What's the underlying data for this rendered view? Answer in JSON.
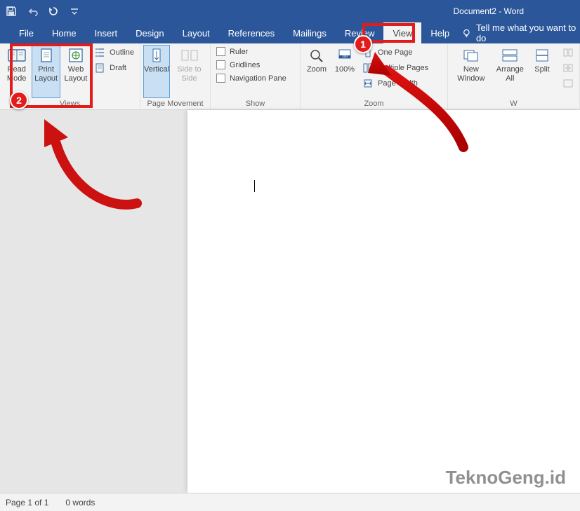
{
  "titlebar": {
    "title": "Document2  -  Word"
  },
  "tabs": {
    "file": "File",
    "home": "Home",
    "insert": "Insert",
    "design": "Design",
    "layout": "Layout",
    "references": "References",
    "mailings": "Mailings",
    "review": "Review",
    "view": "View",
    "help": "Help",
    "tellme": "Tell me what you want to do"
  },
  "ribbon": {
    "views": {
      "readmode": "Read Mode",
      "printlayout": "Print Layout",
      "weblayout": "Web Layout",
      "outline": "Outline",
      "draft": "Draft",
      "label": "Views"
    },
    "pagemovement": {
      "vertical": "Vertical",
      "side": "Side to Side",
      "label": "Page Movement"
    },
    "show": {
      "ruler": "Ruler",
      "gridlines": "Gridlines",
      "nav": "Navigation Pane",
      "label": "Show"
    },
    "zoom": {
      "zoom": "Zoom",
      "p100": "100%",
      "onepage": "One Page",
      "multi": "Multiple Pages",
      "pagewidth": "Page Width",
      "label": "Zoom"
    },
    "window": {
      "neww": "New Window",
      "arrange": "Arrange All",
      "split": "Split",
      "label": "W"
    }
  },
  "status": {
    "page": "Page 1 of 1",
    "words": "0 words"
  },
  "watermark": "TeknoGeng.id",
  "annot": {
    "n1": "1",
    "n2": "2"
  }
}
